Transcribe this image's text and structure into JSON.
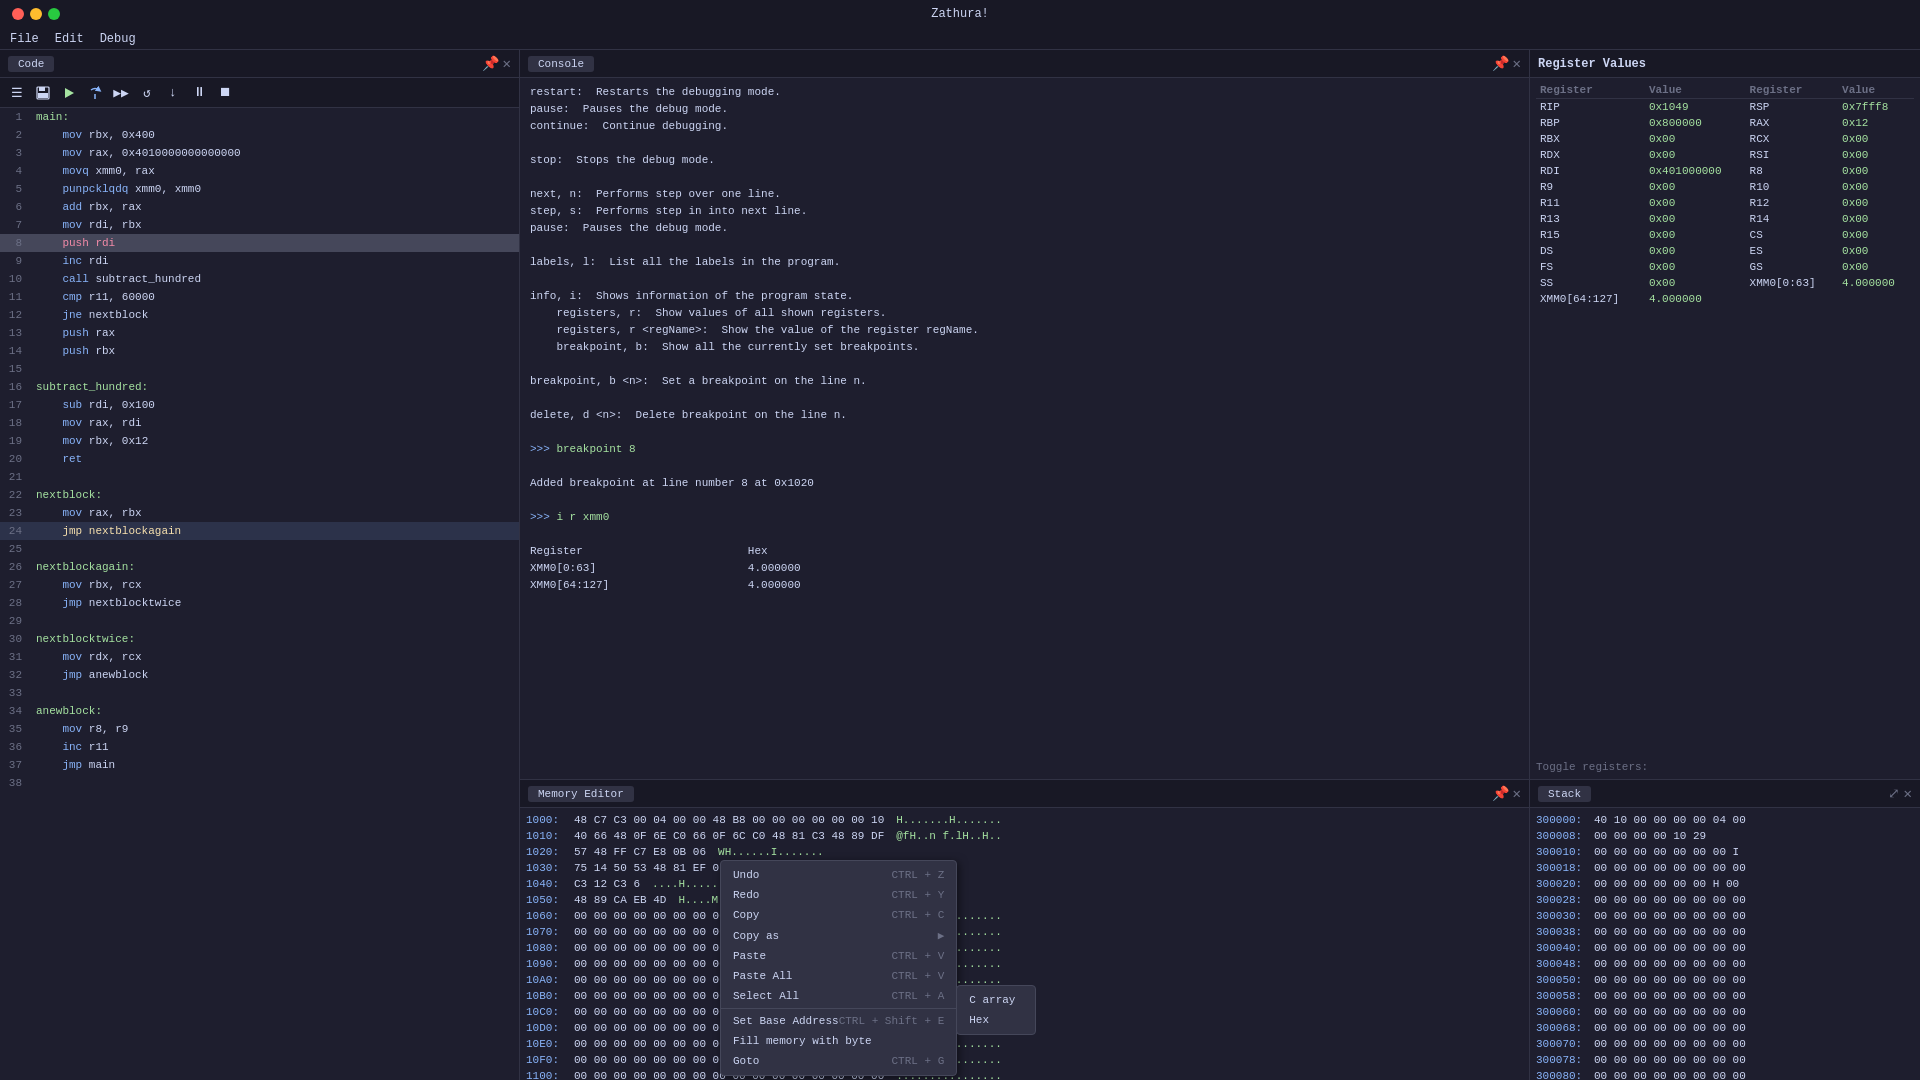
{
  "titleBar": {
    "title": "Zathura!"
  },
  "menuBar": {
    "items": [
      "File",
      "Edit",
      "Debug"
    ]
  },
  "codePanelTab": "Code",
  "consolePanelTab": "Console",
  "memoryPanelTab": "Memory Editor",
  "stackPanelTab": "Stack",
  "registerPanelTitle": "Register Values",
  "toolbar": {
    "buttons": [
      "☰",
      "💾",
      "▶",
      "⤼",
      "▶▶",
      "↺",
      "↓",
      "⏸",
      "⏹"
    ]
  },
  "codeLines": [
    {
      "num": 1,
      "text": "main:",
      "highlight": false
    },
    {
      "num": 2,
      "text": "    mov rbx, 0x400",
      "highlight": false
    },
    {
      "num": 3,
      "text": "    mov rax, 0x4010000000000000",
      "highlight": false
    },
    {
      "num": 4,
      "text": "    movq xmm0, rax",
      "highlight": false
    },
    {
      "num": 5,
      "text": "    punpcklqdq xmm0, xmm0",
      "highlight": false
    },
    {
      "num": 6,
      "text": "    add rbx, rax",
      "highlight": false
    },
    {
      "num": 7,
      "text": "    mov rdi, rbx",
      "highlight": false
    },
    {
      "num": 8,
      "text": "    push rdi",
      "highlight": true,
      "activeBreak": true
    },
    {
      "num": 9,
      "text": "    inc rdi",
      "highlight": false
    },
    {
      "num": 10,
      "text": "    call subtract_hundred",
      "highlight": false
    },
    {
      "num": 11,
      "text": "    cmp r11, 60000",
      "highlight": false
    },
    {
      "num": 12,
      "text": "    jne nextblock",
      "highlight": false
    },
    {
      "num": 13,
      "text": "    push rax",
      "highlight": false
    },
    {
      "num": 14,
      "text": "    push rbx",
      "highlight": false
    },
    {
      "num": 15,
      "text": "    ",
      "highlight": false
    },
    {
      "num": 16,
      "text": "subtract_hundred:",
      "highlight": false
    },
    {
      "num": 17,
      "text": "    sub rdi, 0x100",
      "highlight": false
    },
    {
      "num": 18,
      "text": "    mov rax, rdi",
      "highlight": false
    },
    {
      "num": 19,
      "text": "    mov rbx, 0x12",
      "highlight": false
    },
    {
      "num": 20,
      "text": "    ret",
      "highlight": false
    },
    {
      "num": 21,
      "text": "    ",
      "highlight": false
    },
    {
      "num": 22,
      "text": "nextblock:",
      "highlight": false
    },
    {
      "num": 23,
      "text": "    mov rax, rbx",
      "highlight": false
    },
    {
      "num": 24,
      "text": "    jmp nextblockagain",
      "highlight": true,
      "activeStep": true
    },
    {
      "num": 25,
      "text": "    ",
      "highlight": false
    },
    {
      "num": 26,
      "text": "nextblockagain:",
      "highlight": false
    },
    {
      "num": 27,
      "text": "    mov rbx, rcx",
      "highlight": false
    },
    {
      "num": 28,
      "text": "    jmp nextblocktwice",
      "highlight": false
    },
    {
      "num": 29,
      "text": "    ",
      "highlight": false
    },
    {
      "num": 30,
      "text": "nextblocktwice:",
      "highlight": false
    },
    {
      "num": 31,
      "text": "    mov rdx, rcx",
      "highlight": false
    },
    {
      "num": 32,
      "text": "    jmp anewblock",
      "highlight": false
    },
    {
      "num": 33,
      "text": "    ",
      "highlight": false
    },
    {
      "num": 34,
      "text": "anewblock:",
      "highlight": false
    },
    {
      "num": 35,
      "text": "    mov r8, r9",
      "highlight": false
    },
    {
      "num": 36,
      "text": "    inc r11",
      "highlight": false
    },
    {
      "num": 37,
      "text": "    jmp main",
      "highlight": false
    },
    {
      "num": 38,
      "text": "    ",
      "highlight": false
    }
  ],
  "consoleLines": [
    "restart:  Restarts the debugging mode.",
    "pause:  Pauses the debug mode.",
    "continue:  Continue debugging.",
    "",
    "stop:  Stops the debug mode.",
    "",
    "next, n:  Performs step over one line.",
    "step, s:  Performs step in into next line.",
    "pause:  Pauses the debug mode.",
    "",
    "labels, l:  List all the labels in the program.",
    "",
    "info, i:  Shows information of the program state.",
    "    registers, r:  Show values of all shown registers.",
    "    registers, r <regName>:  Show the value of the register regName.",
    "    breakpoint, b:  Show all the currently set breakpoints.",
    "",
    "breakpoint, b <n>:  Set a breakpoint on the line n.",
    "",
    "delete, d <n>:  Delete breakpoint on the line n.",
    "",
    ">>> breakpoint 8",
    "",
    "Added breakpoint at line number 8 at 0x1020",
    "",
    ">>> i r xmm0",
    "",
    "Register                         Hex",
    "XMM0[0:63]                       4.000000",
    "XMM0[64:127]                     4.000000"
  ],
  "registers": {
    "headers": [
      "Register",
      "Value",
      "Register",
      "Value"
    ],
    "rows": [
      [
        "RIP",
        "0x1049",
        "RSP",
        "0x7fff8"
      ],
      [
        "RBP",
        "0x800000",
        "RAX",
        "0x12"
      ],
      [
        "RBX",
        "0x00",
        "RCX",
        "0x00"
      ],
      [
        "RDX",
        "0x00",
        "RSI",
        "0x00"
      ],
      [
        "RDI",
        "0x401000000",
        "R8",
        "0x00"
      ],
      [
        "R9",
        "0x00",
        "R10",
        "0x00"
      ],
      [
        "R11",
        "0x00",
        "R12",
        "0x00"
      ],
      [
        "R13",
        "0x00",
        "R14",
        "0x00"
      ],
      [
        "R15",
        "0x00",
        "CS",
        "0x00"
      ],
      [
        "DS",
        "0x00",
        "ES",
        "0x00"
      ],
      [
        "FS",
        "0x00",
        "GS",
        "0x00"
      ],
      [
        "SS",
        "0x00",
        "XMM0[0:63]",
        "4.000000"
      ],
      [
        "XMM0[64:127]",
        "4.000000",
        "",
        ""
      ]
    ],
    "toggleLabel": "Toggle registers:"
  },
  "memoryRows": [
    {
      "addr": "1000:",
      "bytes": "48 C7 C3 00 04 00 00 48 B8 00 00 00 00 00 00 10",
      "ascii": "H.......H......."
    },
    {
      "addr": "1010:",
      "bytes": "40 66 48 0F 6E C0 66 0F 6C C0 48 81 C3 48 89 DF",
      "ascii": "@fH..n..fH..H..."
    },
    {
      "addr": "1020:",
      "bytes": "57 48 FF C7 E8 0B 00 00 06",
      "ascii": "WH.......I......"
    },
    {
      "addr": "1030:",
      "bytes": "75 14 50 53 48 81 EF 01 48 89 F8 48 C7",
      "ascii": "u PSH....H..H..."
    },
    {
      "addr": "1040:",
      "bytes": "C3 12 C3 6",
      "ascii": "....H.......H..."
    },
    {
      "addr": "1050:",
      "bytes": "48 89 CA EB 4D",
      "ascii": "H....M..I......."
    },
    {
      "addr": "1060:",
      "bytes": "00 00 00 00 00 00 00 00 00 00 00 00 00 00 00 00",
      "ascii": "................"
    },
    {
      "addr": "1070:",
      "bytes": "00 00 00 00 00 00 00 00 00 00 00 00 00 00 00 00",
      "ascii": "................"
    },
    {
      "addr": "1080:",
      "bytes": "00 00 00 00 00 00 00 00 00 00 00 00 00 00 00 00",
      "ascii": "................"
    },
    {
      "addr": "1090:",
      "bytes": "00 00 00 00 00 00 00 00 00 00 00 00 00 00 00 00",
      "ascii": "................"
    },
    {
      "addr": "10A0:",
      "bytes": "00 00 00 00 00 00 00 00 00 00 00 00 00 00 00 00",
      "ascii": "................"
    },
    {
      "addr": "10B0:",
      "bytes": "00 00 00 00 00 00 00 00 00 00 00 00 00 00 00 00",
      "ascii": "................"
    },
    {
      "addr": "10C0:",
      "bytes": "00 00 00 00 00 00 00 00 00 00 00 00 00 00 00 00",
      "ascii": "................"
    },
    {
      "addr": "10D0:",
      "bytes": "00 00 00 00 00 00 00 00 00 00 00 00 00 00 00 00",
      "ascii": "................"
    },
    {
      "addr": "10E0:",
      "bytes": "00 00 00 00 00 00 00 00 00 00 00 00 00 00 00 00",
      "ascii": "................"
    },
    {
      "addr": "10F0:",
      "bytes": "00 00 00 00 00 00 00 00 00 00 00 00 00 00 00 00",
      "ascii": "................"
    },
    {
      "addr": "1100:",
      "bytes": "00 00 00 00 00 00 00 00 00 00 00 00 00 00 00 00",
      "ascii": "................"
    }
  ],
  "contextMenu": {
    "items": [
      {
        "label": "Undo",
        "shortcut": "CTRL + Z",
        "separator": false,
        "arrow": false
      },
      {
        "label": "Redo",
        "shortcut": "CTRL + Y",
        "separator": false,
        "arrow": false
      },
      {
        "label": "Copy",
        "shortcut": "CTRL + C",
        "separator": false,
        "arrow": false
      },
      {
        "label": "Copy as",
        "shortcut": "",
        "separator": false,
        "arrow": true
      },
      {
        "label": "Paste",
        "shortcut": "CTRL + V",
        "separator": false,
        "arrow": false
      },
      {
        "label": "Paste All",
        "shortcut": "CTRL + V",
        "separator": false,
        "arrow": false
      },
      {
        "label": "Select All",
        "shortcut": "CTRL + A",
        "separator": false,
        "arrow": false
      },
      {
        "label": "Set Base Address",
        "shortcut": "CTRL + Shift + E",
        "separator": false,
        "arrow": false
      },
      {
        "label": "Fill memory with byte",
        "shortcut": "",
        "separator": false,
        "arrow": false
      },
      {
        "label": "Goto",
        "shortcut": "CTRL + G",
        "separator": false,
        "arrow": false
      }
    ],
    "submenuItems": [
      "C array",
      "Hex"
    ]
  },
  "stackRows": [
    {
      "addr": "300000:",
      "bytes": "40 10 00 00 00 00 04 00"
    },
    {
      "addr": "300008:",
      "bytes": "00 00 00 00 10 29"
    },
    {
      "addr": "300010:",
      "bytes": "00 00 00 00 00 00 00 I"
    },
    {
      "addr": "300018:",
      "bytes": "00 00 00 00 00 00 00 00"
    },
    {
      "addr": "300020:",
      "bytes": "00 00 00 00 00 00 H 00"
    },
    {
      "addr": "300028:",
      "bytes": "00 00 00 00 00 00 00 00"
    },
    {
      "addr": "300030:",
      "bytes": "00 00 00 00 00 00 00 00"
    },
    {
      "addr": "300038:",
      "bytes": "00 00 00 00 00 00 00 00"
    },
    {
      "addr": "300040:",
      "bytes": "00 00 00 00 00 00 00 00"
    },
    {
      "addr": "300048:",
      "bytes": "00 00 00 00 00 00 00 00"
    },
    {
      "addr": "300050:",
      "bytes": "00 00 00 00 00 00 00 00"
    },
    {
      "addr": "300058:",
      "bytes": "00 00 00 00 00 00 00 00"
    },
    {
      "addr": "300060:",
      "bytes": "00 00 00 00 00 00 00 00"
    },
    {
      "addr": "300068:",
      "bytes": "00 00 00 00 00 00 00 00"
    },
    {
      "addr": "300070:",
      "bytes": "00 00 00 00 00 00 00 00"
    },
    {
      "addr": "300078:",
      "bytes": "00 00 00 00 00 00 00 00"
    },
    {
      "addr": "300080:",
      "bytes": "00 00 00 00 00 00 00 00"
    },
    {
      "addr": "300088:",
      "bytes": "00 00 00 00 00 00 00 00"
    }
  ]
}
